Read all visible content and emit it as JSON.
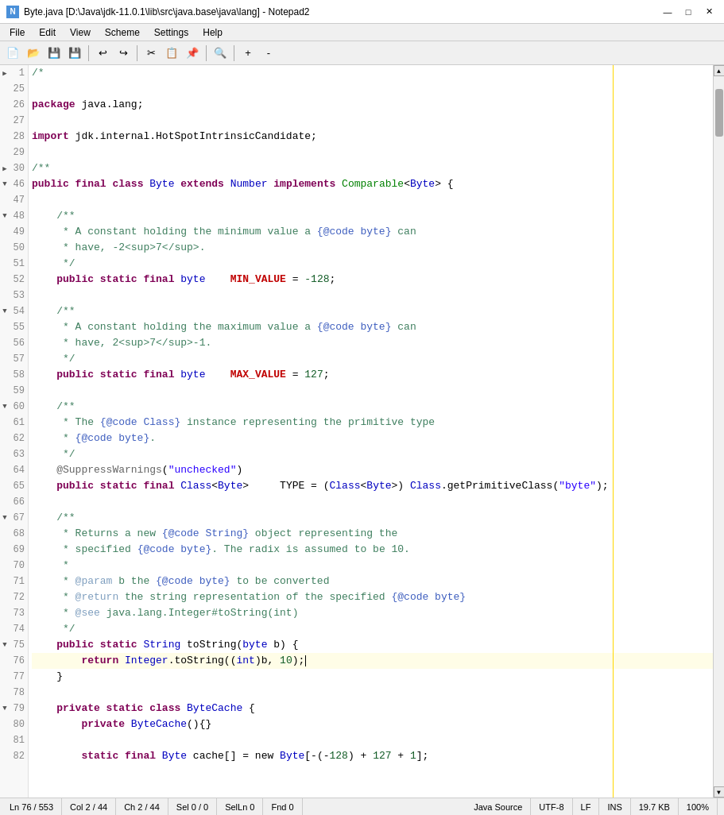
{
  "window": {
    "title": "Byte.java [D:\\Java\\jdk-11.0.1\\lib\\src\\java.base\\java\\lang] - Notepad2",
    "icon_label": "N2"
  },
  "menu": {
    "items": [
      "File",
      "Edit",
      "View",
      "Scheme",
      "Settings",
      "Help"
    ]
  },
  "toolbar": {
    "buttons": [
      {
        "name": "new",
        "icon": "📄"
      },
      {
        "name": "open",
        "icon": "📂"
      },
      {
        "name": "save",
        "icon": "💾"
      },
      {
        "name": "save-all",
        "icon": "💾"
      },
      {
        "name": "undo",
        "icon": "↩"
      },
      {
        "name": "redo",
        "icon": "↪"
      },
      {
        "name": "cut",
        "icon": "✂"
      },
      {
        "name": "copy",
        "icon": "📋"
      },
      {
        "name": "paste",
        "icon": "📌"
      },
      {
        "name": "find",
        "icon": "🔍"
      },
      {
        "name": "zoom-in",
        "icon": "+"
      },
      {
        "name": "zoom-out",
        "icon": "-"
      }
    ]
  },
  "code": {
    "lines": [
      {
        "num": 1,
        "fold": "▶",
        "content": "/*",
        "tokens": [
          {
            "text": "/*",
            "class": "comment"
          }
        ]
      },
      {
        "num": 25,
        "fold": "",
        "content": "",
        "tokens": []
      },
      {
        "num": 26,
        "fold": "",
        "content": "package java.lang;",
        "tokens": [
          {
            "text": "package ",
            "class": "kw2"
          },
          {
            "text": "java.lang;",
            "class": "normal"
          }
        ]
      },
      {
        "num": 27,
        "fold": "",
        "content": "",
        "tokens": []
      },
      {
        "num": 28,
        "fold": "",
        "content": "import jdk.internal.HotSpotIntrinsicCandidate;",
        "tokens": [
          {
            "text": "import ",
            "class": "kw2"
          },
          {
            "text": "jdk.internal.HotSpotIntrinsicCandidate;",
            "class": "normal"
          }
        ]
      },
      {
        "num": 29,
        "fold": "",
        "content": "",
        "tokens": []
      },
      {
        "num": 30,
        "fold": "▶",
        "content": "/**",
        "tokens": [
          {
            "text": "/**",
            "class": "comment"
          }
        ]
      },
      {
        "num": 46,
        "fold": "▼",
        "content": "public final class Byte extends Number implements Comparable<Byte> {",
        "tokens": [
          {
            "text": "public final ",
            "class": "kw2"
          },
          {
            "text": "class ",
            "class": "kw2"
          },
          {
            "text": "Byte ",
            "class": "classname"
          },
          {
            "text": "extends ",
            "class": "kw2"
          },
          {
            "text": "Number ",
            "class": "classname"
          },
          {
            "text": "implements ",
            "class": "kw2"
          },
          {
            "text": "Comparable",
            "class": "interface"
          },
          {
            "text": "<",
            "class": "normal"
          },
          {
            "text": "Byte",
            "class": "classname"
          },
          {
            "text": "> {",
            "class": "normal"
          }
        ]
      },
      {
        "num": 47,
        "fold": "",
        "content": "",
        "tokens": []
      },
      {
        "num": 48,
        "fold": "▼",
        "content": "    /**",
        "tokens": [
          {
            "text": "    /**",
            "class": "comment"
          }
        ]
      },
      {
        "num": 49,
        "fold": "",
        "content": "     * A constant holding the minimum value a {@code byte} can",
        "tokens": [
          {
            "text": "     * A constant holding the minimum value a ",
            "class": "comment"
          },
          {
            "text": "{@code byte}",
            "class": "javadoc"
          },
          {
            "text": " can",
            "class": "comment"
          }
        ]
      },
      {
        "num": 50,
        "fold": "",
        "content": "     * have, -2<sup>7</sup>.",
        "tokens": [
          {
            "text": "     * have, -2<sup>7</sup>.",
            "class": "comment"
          }
        ]
      },
      {
        "num": 51,
        "fold": "",
        "content": "     */",
        "tokens": [
          {
            "text": "     */",
            "class": "comment"
          }
        ]
      },
      {
        "num": 52,
        "fold": "",
        "content": "    public static final byte    MIN_VALUE = -128;",
        "tokens": [
          {
            "text": "    public static final ",
            "class": "kw2"
          },
          {
            "text": "byte",
            "class": "type"
          },
          {
            "text": "    ",
            "class": "normal"
          },
          {
            "text": "MIN_VALUE",
            "class": "constant"
          },
          {
            "text": " = ",
            "class": "normal"
          },
          {
            "text": "-128",
            "class": "number"
          },
          {
            "text": ";",
            "class": "normal"
          }
        ]
      },
      {
        "num": 53,
        "fold": "",
        "content": "",
        "tokens": []
      },
      {
        "num": 54,
        "fold": "▼",
        "content": "    /**",
        "tokens": [
          {
            "text": "    /**",
            "class": "comment"
          }
        ]
      },
      {
        "num": 55,
        "fold": "",
        "content": "     * A constant holding the maximum value a {@code byte} can",
        "tokens": [
          {
            "text": "     * A constant holding the maximum value a ",
            "class": "comment"
          },
          {
            "text": "{@code byte}",
            "class": "javadoc"
          },
          {
            "text": " can",
            "class": "comment"
          }
        ]
      },
      {
        "num": 56,
        "fold": "",
        "content": "     * have, 2<sup>7</sup>-1.",
        "tokens": [
          {
            "text": "     * have, 2<sup>7</sup>-1.",
            "class": "comment"
          }
        ]
      },
      {
        "num": 57,
        "fold": "",
        "content": "     */",
        "tokens": [
          {
            "text": "     */",
            "class": "comment"
          }
        ]
      },
      {
        "num": 58,
        "fold": "",
        "content": "    public static final byte    MAX_VALUE = 127;",
        "tokens": [
          {
            "text": "    public static final ",
            "class": "kw2"
          },
          {
            "text": "byte",
            "class": "type"
          },
          {
            "text": "    ",
            "class": "normal"
          },
          {
            "text": "MAX_VALUE",
            "class": "constant"
          },
          {
            "text": " = ",
            "class": "normal"
          },
          {
            "text": "127",
            "class": "number"
          },
          {
            "text": ";",
            "class": "normal"
          }
        ]
      },
      {
        "num": 59,
        "fold": "",
        "content": "",
        "tokens": []
      },
      {
        "num": 60,
        "fold": "▼",
        "content": "    /**",
        "tokens": [
          {
            "text": "    /**",
            "class": "comment"
          }
        ]
      },
      {
        "num": 61,
        "fold": "",
        "content": "     * The {@code Class} instance representing the primitive type",
        "tokens": [
          {
            "text": "     * The ",
            "class": "comment"
          },
          {
            "text": "{@code Class}",
            "class": "javadoc"
          },
          {
            "text": " instance representing the primitive type",
            "class": "comment"
          }
        ]
      },
      {
        "num": 62,
        "fold": "",
        "content": "     * {@code byte}.",
        "tokens": [
          {
            "text": "     * ",
            "class": "comment"
          },
          {
            "text": "{@code byte}",
            "class": "javadoc"
          },
          {
            "text": ".",
            "class": "comment"
          }
        ]
      },
      {
        "num": 63,
        "fold": "",
        "content": "     */",
        "tokens": [
          {
            "text": "     */",
            "class": "comment"
          }
        ]
      },
      {
        "num": 64,
        "fold": "",
        "content": "    @SuppressWarnings(\"unchecked\")",
        "tokens": [
          {
            "text": "    @SuppressWarnings",
            "class": "annotation"
          },
          {
            "text": "(",
            "class": "normal"
          },
          {
            "text": "\"unchecked\"",
            "class": "string"
          },
          {
            "text": ")",
            "class": "normal"
          }
        ]
      },
      {
        "num": 65,
        "fold": "",
        "content": "    public static final Class<Byte>     TYPE = (Class<Byte>) Class.getPrimitiveClass(\"byte\");",
        "tokens": [
          {
            "text": "    public static final ",
            "class": "kw2"
          },
          {
            "text": "Class",
            "class": "classname"
          },
          {
            "text": "<",
            "class": "normal"
          },
          {
            "text": "Byte",
            "class": "classname"
          },
          {
            "text": ">     TYPE = (",
            "class": "normal"
          },
          {
            "text": "Class",
            "class": "classname"
          },
          {
            "text": "<",
            "class": "normal"
          },
          {
            "text": "Byte",
            "class": "classname"
          },
          {
            "text": ">) ",
            "class": "normal"
          },
          {
            "text": "Class",
            "class": "classname"
          },
          {
            "text": ".getPrimitiveClass(",
            "class": "normal"
          },
          {
            "text": "\"byte\"",
            "class": "string"
          },
          {
            "text": ");",
            "class": "normal"
          }
        ]
      },
      {
        "num": 66,
        "fold": "",
        "content": "",
        "tokens": []
      },
      {
        "num": 67,
        "fold": "▼",
        "content": "    /**",
        "tokens": [
          {
            "text": "    /**",
            "class": "comment"
          }
        ]
      },
      {
        "num": 68,
        "fold": "",
        "content": "     * Returns a new {@code String} object representing the",
        "tokens": [
          {
            "text": "     * Returns a new ",
            "class": "comment"
          },
          {
            "text": "{@code String}",
            "class": "javadoc"
          },
          {
            "text": " object representing the",
            "class": "comment"
          }
        ]
      },
      {
        "num": 69,
        "fold": "",
        "content": "     * specified {@code byte}. The radix is assumed to be 10.",
        "tokens": [
          {
            "text": "     * specified ",
            "class": "comment"
          },
          {
            "text": "{@code byte}",
            "class": "javadoc"
          },
          {
            "text": ". The radix is assumed to be 10.",
            "class": "comment"
          }
        ]
      },
      {
        "num": 70,
        "fold": "",
        "content": "     *",
        "tokens": [
          {
            "text": "     *",
            "class": "comment"
          }
        ]
      },
      {
        "num": 71,
        "fold": "",
        "content": "     * @param b the {@code byte} to be converted",
        "tokens": [
          {
            "text": "     * ",
            "class": "comment"
          },
          {
            "text": "@param",
            "class": "param-tag"
          },
          {
            "text": " b the ",
            "class": "comment"
          },
          {
            "text": "{@code byte}",
            "class": "javadoc"
          },
          {
            "text": " to be converted",
            "class": "comment"
          }
        ]
      },
      {
        "num": 72,
        "fold": "",
        "content": "     * @return the string representation of the specified {@code byte}",
        "tokens": [
          {
            "text": "     * ",
            "class": "comment"
          },
          {
            "text": "@return",
            "class": "param-tag"
          },
          {
            "text": " the string representation of the specified ",
            "class": "comment"
          },
          {
            "text": "{@code byte}",
            "class": "javadoc"
          }
        ]
      },
      {
        "num": 73,
        "fold": "",
        "content": "     * @see java.lang.Integer#toString(int)",
        "tokens": [
          {
            "text": "     * ",
            "class": "comment"
          },
          {
            "text": "@see",
            "class": "param-tag"
          },
          {
            "text": " java.lang.Integer#toString(int)",
            "class": "comment"
          }
        ]
      },
      {
        "num": 74,
        "fold": "",
        "content": "     */",
        "tokens": [
          {
            "text": "     */",
            "class": "comment"
          }
        ]
      },
      {
        "num": 75,
        "fold": "▼",
        "content": "    public static String toString(byte b) {",
        "tokens": [
          {
            "text": "    public static ",
            "class": "kw2"
          },
          {
            "text": "String",
            "class": "classname"
          },
          {
            "text": " toString(",
            "class": "normal"
          },
          {
            "text": "byte",
            "class": "type"
          },
          {
            "text": " b) {",
            "class": "normal"
          }
        ]
      },
      {
        "num": 76,
        "fold": "",
        "content": "        return Integer.toString((int)b, 10);",
        "tokens": [
          {
            "text": "        return ",
            "class": "kw2"
          },
          {
            "text": "Integer",
            "class": "classname"
          },
          {
            "text": ".toString((",
            "class": "normal"
          },
          {
            "text": "int",
            "class": "type"
          },
          {
            "text": ")b, ",
            "class": "normal"
          },
          {
            "text": "10",
            "class": "number"
          },
          {
            "text": ");",
            "class": "normal"
          }
        ],
        "cursor": true
      },
      {
        "num": 77,
        "fold": "",
        "content": "    }",
        "tokens": [
          {
            "text": "    }",
            "class": "normal"
          }
        ]
      },
      {
        "num": 78,
        "fold": "",
        "content": "",
        "tokens": []
      },
      {
        "num": 79,
        "fold": "▼",
        "content": "    private static class ByteCache {",
        "tokens": [
          {
            "text": "    private static ",
            "class": "kw2"
          },
          {
            "text": "class ",
            "class": "kw2"
          },
          {
            "text": "ByteCache",
            "class": "classname"
          },
          {
            "text": " {",
            "class": "normal"
          }
        ]
      },
      {
        "num": 80,
        "fold": "",
        "content": "        private ByteCache(){}",
        "tokens": [
          {
            "text": "        private ",
            "class": "kw2"
          },
          {
            "text": "ByteCache",
            "class": "classname"
          },
          {
            "text": "(){}",
            "class": "normal"
          }
        ]
      },
      {
        "num": 81,
        "fold": "",
        "content": "",
        "tokens": []
      },
      {
        "num": 82,
        "fold": "",
        "content": "        static final Byte cache[] = new Byte[-(-128) + 127 + 1];",
        "tokens": [
          {
            "text": "        static final ",
            "class": "kw2"
          },
          {
            "text": "Byte",
            "class": "classname"
          },
          {
            "text": " cache[] = new ",
            "class": "normal"
          },
          {
            "text": "Byte",
            "class": "classname"
          },
          {
            "text": "[-(-",
            "class": "normal"
          },
          {
            "text": "128",
            "class": "number"
          },
          {
            "text": ") + ",
            "class": "normal"
          },
          {
            "text": "127",
            "class": "number"
          },
          {
            "text": " + ",
            "class": "normal"
          },
          {
            "text": "1",
            "class": "number"
          },
          {
            "text": "];",
            "class": "normal"
          }
        ]
      }
    ]
  },
  "status_bar": {
    "position": "Ln 76 / 553",
    "col": "Col 2 / 44",
    "ch": "Ch 2 / 44",
    "sel": "Sel 0 / 0",
    "selln": "SelLn 0",
    "fnd": "Fnd 0",
    "lang": "Java Source",
    "encoding": "UTF-8",
    "eol": "LF",
    "ins": "INS",
    "size": "19.7 KB",
    "zoom": "100%"
  }
}
